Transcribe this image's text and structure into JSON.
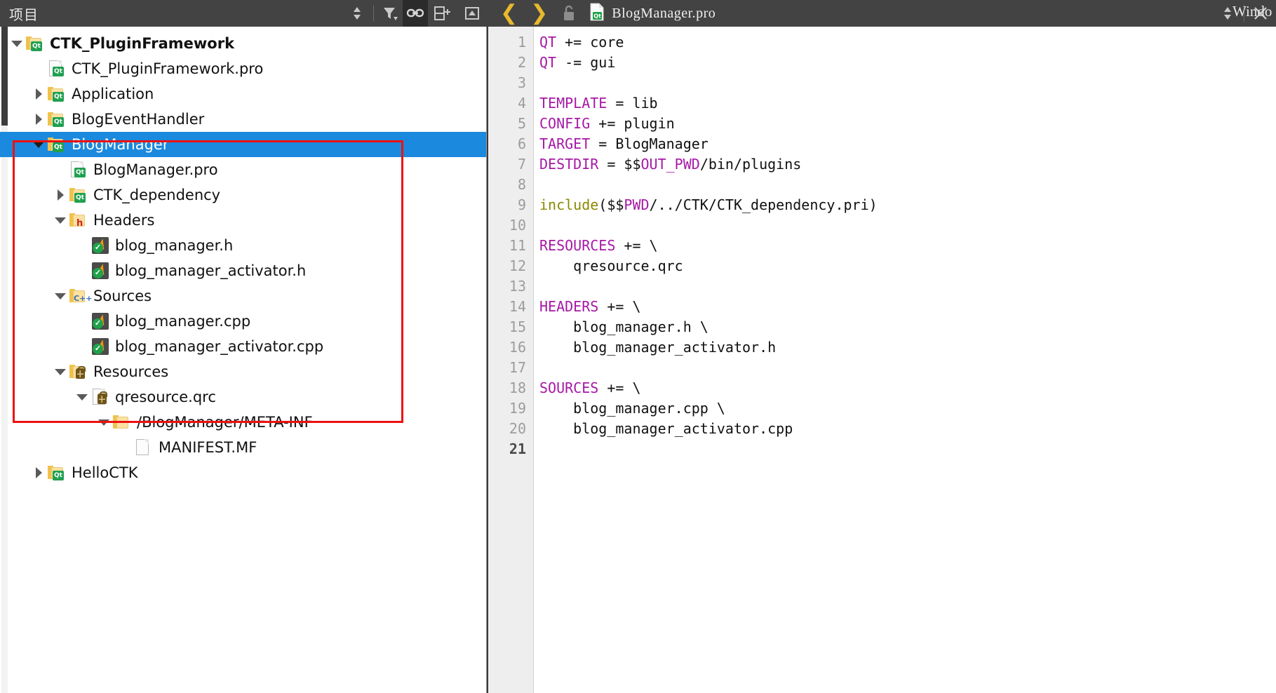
{
  "toolbar": {
    "panel_title": "项目",
    "sort_icon": "sort-updown-icon",
    "filter_icon": "filter-icon",
    "link_icon": "link-sync-icon",
    "split_icon": "split-add-icon",
    "collapse_icon": "collapse-icon",
    "back_icon": "chevron-left-icon",
    "forward_icon": "chevron-right-icon",
    "lock_icon": "unlocked-padlock-icon",
    "file_icon": "qt-pro-file-icon",
    "filename": "BlogManager.pro",
    "updown_icon": "updown-arrows-icon",
    "close_icon": "close-x-icon",
    "window_label": "Windo"
  },
  "tree": {
    "items": [
      {
        "label": "CTK_PluginFramework",
        "indent": 0,
        "arrow": "down",
        "icon": "qt-folder-icon",
        "bold": true,
        "selected": false
      },
      {
        "label": "CTK_PluginFramework.pro",
        "indent": 1,
        "arrow": "none",
        "icon": "qt-pro-file-icon",
        "bold": false,
        "selected": false
      },
      {
        "label": "Application",
        "indent": 1,
        "arrow": "right",
        "icon": "qt-folder-icon",
        "bold": false,
        "selected": false
      },
      {
        "label": "BlogEventHandler",
        "indent": 1,
        "arrow": "right",
        "icon": "qt-folder-icon",
        "bold": false,
        "selected": false
      },
      {
        "label": "BlogManager",
        "indent": 1,
        "arrow": "down",
        "icon": "qt-folder-icon",
        "bold": false,
        "selected": true
      },
      {
        "label": "BlogManager.pro",
        "indent": 2,
        "arrow": "none",
        "icon": "qt-pro-file-icon",
        "bold": false,
        "selected": false
      },
      {
        "label": "CTK_dependency",
        "indent": 2,
        "arrow": "right",
        "icon": "qt-folder-icon",
        "bold": false,
        "selected": false
      },
      {
        "label": "Headers",
        "indent": 2,
        "arrow": "down",
        "icon": "h-folder-icon",
        "bold": false,
        "selected": false
      },
      {
        "label": "blog_manager.h",
        "indent": 3,
        "arrow": "none",
        "icon": "source-file-icon",
        "bold": false,
        "selected": false
      },
      {
        "label": "blog_manager_activator.h",
        "indent": 3,
        "arrow": "none",
        "icon": "source-file-icon",
        "bold": false,
        "selected": false
      },
      {
        "label": "Sources",
        "indent": 2,
        "arrow": "down",
        "icon": "cpp-folder-icon",
        "bold": false,
        "selected": false
      },
      {
        "label": "blog_manager.cpp",
        "indent": 3,
        "arrow": "none",
        "icon": "source-file-icon",
        "bold": false,
        "selected": false
      },
      {
        "label": "blog_manager_activator.cpp",
        "indent": 3,
        "arrow": "none",
        "icon": "source-file-icon",
        "bold": false,
        "selected": false
      },
      {
        "label": "Resources",
        "indent": 2,
        "arrow": "down",
        "icon": "resource-folder-icon",
        "bold": false,
        "selected": false
      },
      {
        "label": "qresource.qrc",
        "indent": 3,
        "arrow": "down",
        "icon": "qrc-file-icon",
        "bold": false,
        "selected": false
      },
      {
        "label": "/BlogManager/META-INF",
        "indent": 4,
        "arrow": "down",
        "icon": "plain-folder-icon",
        "bold": false,
        "selected": false
      },
      {
        "label": "MANIFEST.MF",
        "indent": 5,
        "arrow": "none",
        "icon": "plain-file-icon",
        "bold": false,
        "selected": false
      },
      {
        "label": "HelloCTK",
        "indent": 1,
        "arrow": "right",
        "icon": "qt-folder-icon",
        "bold": false,
        "selected": false
      }
    ]
  },
  "editor": {
    "line_numbers": [
      "1",
      "2",
      "3",
      "4",
      "5",
      "6",
      "7",
      "8",
      "9",
      "10",
      "11",
      "12",
      "13",
      "14",
      "15",
      "16",
      "17",
      "18",
      "19",
      "20",
      "21"
    ],
    "current_line": "21",
    "lines": [
      [
        {
          "t": "QT",
          "c": "kw"
        },
        {
          "t": " += core",
          "c": "plain"
        }
      ],
      [
        {
          "t": "QT",
          "c": "kw"
        },
        {
          "t": " -= gui",
          "c": "plain"
        }
      ],
      [],
      [
        {
          "t": "TEMPLATE",
          "c": "kw"
        },
        {
          "t": " = lib",
          "c": "plain"
        }
      ],
      [
        {
          "t": "CONFIG",
          "c": "kw"
        },
        {
          "t": " += plugin",
          "c": "plain"
        }
      ],
      [
        {
          "t": "TARGET",
          "c": "kw"
        },
        {
          "t": " = BlogManager",
          "c": "plain"
        }
      ],
      [
        {
          "t": "DESTDIR",
          "c": "kw"
        },
        {
          "t": " = $$",
          "c": "plain"
        },
        {
          "t": "OUT_PWD",
          "c": "kw"
        },
        {
          "t": "/bin/plugins",
          "c": "plain"
        }
      ],
      [],
      [
        {
          "t": "include",
          "c": "fn"
        },
        {
          "t": "($$",
          "c": "plain"
        },
        {
          "t": "PWD",
          "c": "kw"
        },
        {
          "t": "/../CTK/CTK_dependency.pri)",
          "c": "plain"
        }
      ],
      [],
      [
        {
          "t": "RESOURCES",
          "c": "kw"
        },
        {
          "t": " += \\",
          "c": "plain"
        }
      ],
      [
        {
          "t": "    qresource.qrc",
          "c": "plain"
        }
      ],
      [],
      [
        {
          "t": "HEADERS",
          "c": "kw"
        },
        {
          "t": " += \\",
          "c": "plain"
        }
      ],
      [
        {
          "t": "    blog_manager.h \\",
          "c": "plain"
        }
      ],
      [
        {
          "t": "    blog_manager_activator.h",
          "c": "plain"
        }
      ],
      [],
      [
        {
          "t": "SOURCES",
          "c": "kw"
        },
        {
          "t": " += \\",
          "c": "plain"
        }
      ],
      [
        {
          "t": "    blog_manager.cpp \\",
          "c": "plain"
        }
      ],
      [
        {
          "t": "    blog_manager_activator.cpp",
          "c": "plain"
        }
      ],
      []
    ]
  },
  "colors": {
    "selection_blue": "#1b89dd",
    "annotation_red": "#ee1111",
    "toolbar_gray": "#434343",
    "keyword_purple": "#a619a6",
    "function_olive": "#8a8a00"
  }
}
